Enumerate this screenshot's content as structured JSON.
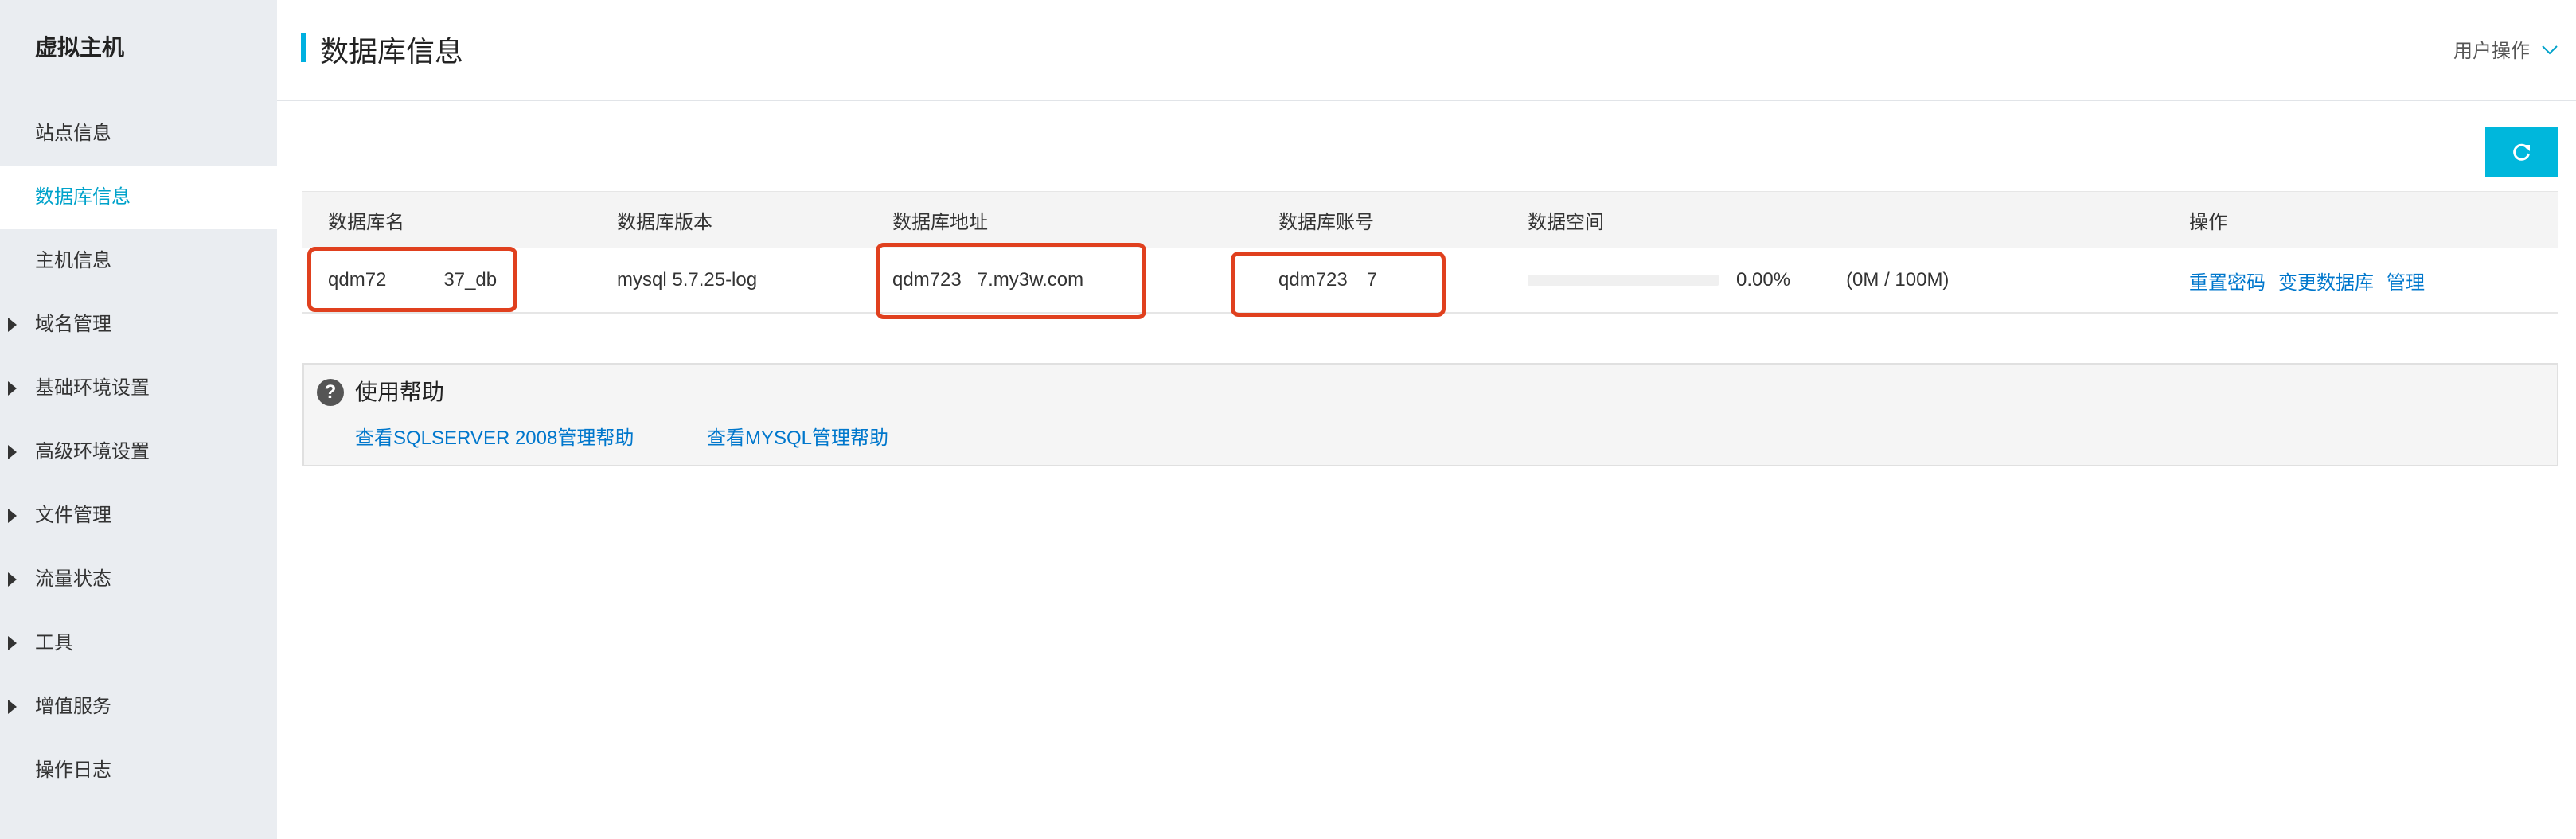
{
  "sidebar": {
    "title": "虚拟主机",
    "items": [
      {
        "label": "站点信息",
        "expandable": false,
        "active": false
      },
      {
        "label": "数据库信息",
        "expandable": false,
        "active": true
      },
      {
        "label": "主机信息",
        "expandable": false,
        "active": false
      },
      {
        "label": "域名管理",
        "expandable": true,
        "active": false
      },
      {
        "label": "基础环境设置",
        "expandable": true,
        "active": false
      },
      {
        "label": "高级环境设置",
        "expandable": true,
        "active": false
      },
      {
        "label": "文件管理",
        "expandable": true,
        "active": false
      },
      {
        "label": "流量状态",
        "expandable": true,
        "active": false
      },
      {
        "label": "工具",
        "expandable": true,
        "active": false
      },
      {
        "label": "增值服务",
        "expandable": true,
        "active": false
      },
      {
        "label": "操作日志",
        "expandable": false,
        "active": false
      }
    ]
  },
  "header": {
    "title": "数据库信息",
    "user_menu": "用户操作"
  },
  "table": {
    "headers": {
      "name": "数据库名",
      "version": "数据库版本",
      "address": "数据库地址",
      "account": "数据库账号",
      "space": "数据空间",
      "ops": "操作"
    },
    "rows": [
      {
        "name_a": "qdm72",
        "name_b": "37_db",
        "version": "mysql 5.7.25-log",
        "address_a": "qdm723",
        "address_b": "7.my3w.com",
        "account_a": "qdm723",
        "account_b": "7",
        "space_pct": "0.00%",
        "space_fraction": 0,
        "space_usage": "(0M / 100M)",
        "ops": {
          "reset": "重置密码",
          "change": "变更数据库",
          "manage": "管理"
        }
      }
    ]
  },
  "help": {
    "title": "使用帮助",
    "links": [
      "查看SQLSERVER 2008管理帮助",
      "查看MYSQL管理帮助"
    ]
  },
  "colors": {
    "accent": "#00b7dc",
    "link": "#0077cc",
    "highlight": "#e0401e",
    "sidebar_bg": "#eaedf1"
  },
  "icons": {
    "refresh": "refresh-icon",
    "help": "question-circle-icon",
    "user_menu": "chevron-down-icon"
  }
}
